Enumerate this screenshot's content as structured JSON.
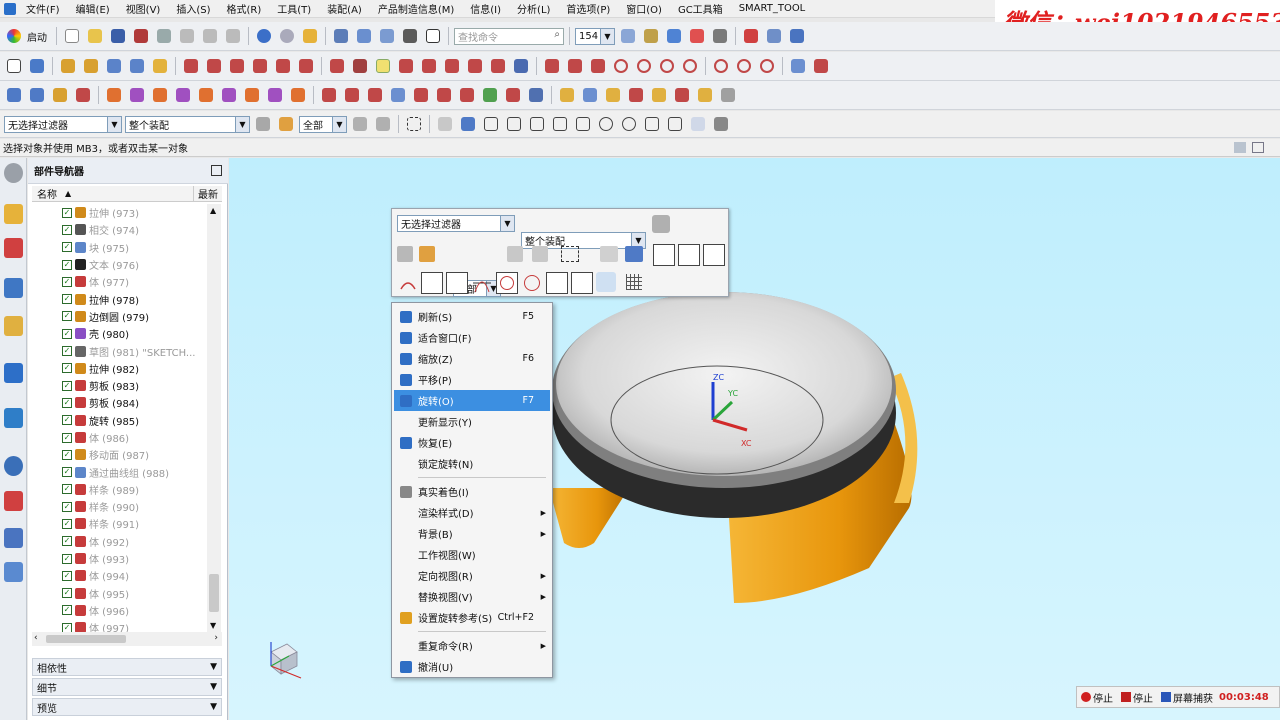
{
  "menu": [
    "文件(F)",
    "编辑(E)",
    "视图(V)",
    "插入(S)",
    "格式(R)",
    "工具(T)",
    "装配(A)",
    "产品制造信息(M)",
    "信息(I)",
    "分析(L)",
    "首选项(P)",
    "窗口(O)",
    "GC工具箱",
    "SMART_TOOL"
  ],
  "watermark": "微信：wei1021946553",
  "toolbar1": {
    "start_label": "启动",
    "search_placeholder": "查找命令",
    "zoom_value": "154"
  },
  "filters": {
    "type_filter": "无选择过滤器",
    "scope": "整个装配",
    "scope_all": "全部"
  },
  "status_prompt": "选择对象并使用 MB3，或者双击某一对象",
  "navigator": {
    "title": "部件导航器",
    "col_name": "名称",
    "col_latest": "最新",
    "items": [
      {
        "label": "拉伸 (973)",
        "dim": true,
        "color": "#d08a1a"
      },
      {
        "label": "相交 (974)",
        "dim": true,
        "color": "#555"
      },
      {
        "label": "块 (975)",
        "dim": true,
        "color": "#5d86c9"
      },
      {
        "label": "文本 (976)",
        "dim": true,
        "color": "#222"
      },
      {
        "label": "体 (977)",
        "dim": true,
        "color": "#c63b3b"
      },
      {
        "label": "拉伸 (978)",
        "dim": false,
        "color": "#d08a1a"
      },
      {
        "label": "边倒圆 (979)",
        "dim": false,
        "color": "#d08a1a"
      },
      {
        "label": "壳 (980)",
        "dim": false,
        "color": "#8a4fc4"
      },
      {
        "label": "草图 (981) \"SKETCH...",
        "dim": true,
        "color": "#666"
      },
      {
        "label": "拉伸 (982)",
        "dim": false,
        "color": "#d08a1a"
      },
      {
        "label": "剪板 (983)",
        "dim": false,
        "color": "#c63b3b"
      },
      {
        "label": "剪板 (984)",
        "dim": false,
        "color": "#c63b3b"
      },
      {
        "label": "旋转 (985)",
        "dim": false,
        "color": "#c63b3b"
      },
      {
        "label": "体 (986)",
        "dim": true,
        "color": "#c63b3b"
      },
      {
        "label": "移动面 (987)",
        "dim": true,
        "color": "#d08a1a"
      },
      {
        "label": "通过曲线组 (988)",
        "dim": true,
        "color": "#5d86c9"
      },
      {
        "label": "样条 (989)",
        "dim": true,
        "color": "#c63b3b"
      },
      {
        "label": "样条 (990)",
        "dim": true,
        "color": "#c63b3b"
      },
      {
        "label": "样条 (991)",
        "dim": true,
        "color": "#c63b3b"
      },
      {
        "label": "体 (992)",
        "dim": true,
        "color": "#c63b3b"
      },
      {
        "label": "体 (993)",
        "dim": true,
        "color": "#c63b3b"
      },
      {
        "label": "体 (994)",
        "dim": true,
        "color": "#c63b3b"
      },
      {
        "label": "体 (995)",
        "dim": true,
        "color": "#c63b3b"
      },
      {
        "label": "体 (996)",
        "dim": true,
        "color": "#c63b3b"
      },
      {
        "label": "体 (997)",
        "dim": true,
        "color": "#c63b3b"
      }
    ],
    "panels": [
      "相依性",
      "细节",
      "预览"
    ]
  },
  "context_menu": [
    {
      "label": "刷新(S)",
      "shortcut": "F5",
      "sub": false,
      "color": "#2f6ec4"
    },
    {
      "label": "适合窗口(F)",
      "shortcut": "",
      "sub": false,
      "color": "#2f6ec4"
    },
    {
      "label": "缩放(Z)",
      "shortcut": "F6",
      "sub": false,
      "color": "#2f6ec4"
    },
    {
      "label": "平移(P)",
      "shortcut": "",
      "sub": false,
      "color": "#2f6ec4"
    },
    {
      "label": "旋转(O)",
      "shortcut": "F7",
      "sub": false,
      "color": "#2f6ec4",
      "highlight": true
    },
    {
      "label": "更新显示(Y)",
      "shortcut": "",
      "sub": false,
      "color": ""
    },
    {
      "label": "恢复(E)",
      "shortcut": "",
      "sub": false,
      "color": "#2f6ec4"
    },
    {
      "label": "锁定旋转(N)",
      "shortcut": "",
      "sub": false,
      "color": ""
    },
    {
      "label": "真实着色(I)",
      "shortcut": "",
      "sub": false,
      "color": "#888",
      "sep_before": true
    },
    {
      "label": "渲染样式(D)",
      "shortcut": "",
      "sub": true,
      "color": ""
    },
    {
      "label": "背景(B)",
      "shortcut": "",
      "sub": true,
      "color": ""
    },
    {
      "label": "工作视图(W)",
      "shortcut": "",
      "sub": false,
      "color": ""
    },
    {
      "label": "定向视图(R)",
      "shortcut": "",
      "sub": true,
      "color": ""
    },
    {
      "label": "替换视图(V)",
      "shortcut": "",
      "sub": true,
      "color": ""
    },
    {
      "label": "设置旋转参考(S)",
      "shortcut": "Ctrl+F2",
      "sub": false,
      "color": "#e0a020"
    },
    {
      "label": "重复命令(R)",
      "shortcut": "",
      "sub": true,
      "color": "",
      "sep_before": true
    },
    {
      "label": "撤消(U)",
      "shortcut": "",
      "sub": false,
      "color": "#2f6ec4"
    }
  ],
  "recorder": {
    "stop1": "停止",
    "stop2": "停止",
    "capture": "屏幕捕获",
    "time": "00:03:48"
  },
  "axes": {
    "zc": "ZC",
    "yc": "YC",
    "xc": "XC"
  }
}
